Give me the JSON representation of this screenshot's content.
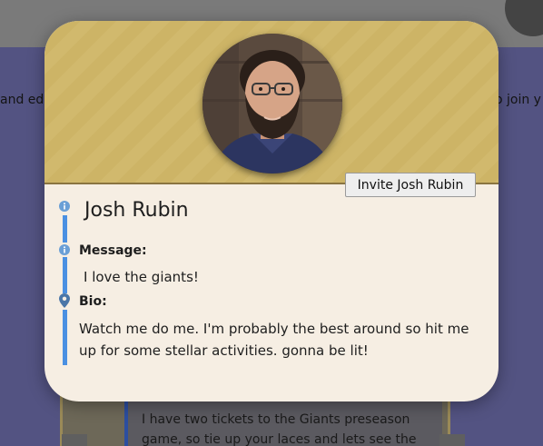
{
  "background": {
    "left_text": "and edi",
    "right_text": "o join y",
    "card_text": "I have two tickets to the Giants preseason game, so tie up your laces and lets see the"
  },
  "profile": {
    "name": "Josh Rubin",
    "invite_label": "Invite Josh Rubin",
    "message_label": "Message:",
    "message": "I love the giants!",
    "bio_label": "Bio:",
    "bio": "Watch me do me. I'm probably the best around so hit me up for some stellar activities. gonna be lit!"
  },
  "colors": {
    "header_bg": "#d1b96d",
    "card_bg": "#f6eee3",
    "accent_line": "#4a90e2",
    "info_icon": "#6a9fd6",
    "pin_icon": "#4a76a8",
    "backdrop": "#535382"
  },
  "icons": [
    "info-icon",
    "info-icon",
    "location-pin-icon"
  ]
}
